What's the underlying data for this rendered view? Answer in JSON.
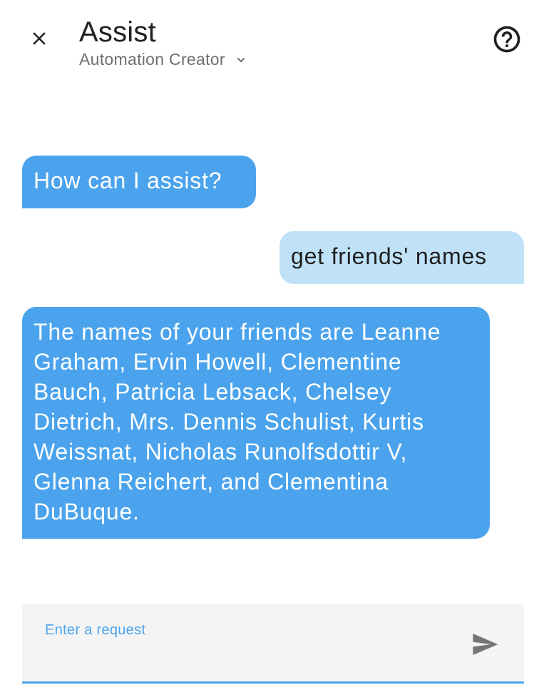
{
  "header": {
    "title": "Assist",
    "pipeline": "Automation Creator",
    "close_icon": "close-icon",
    "help_icon": "help-circle-icon",
    "chevron_icon": "chevron-down-icon"
  },
  "conversation": [
    {
      "who": "hass",
      "text": "How can I assist?"
    },
    {
      "who": "user",
      "text": "get friends' names"
    },
    {
      "who": "hass",
      "text": "The names of your friends are Leanne Graham, Ervin Howell, Clementine Bauch, Patricia Lebsack, Chelsey Dietrich, Mrs. Dennis Schulist, Kurtis Weissnat, Nicholas Runolfsdottir V, Glenna Reichert, and Clementina DuBuque."
    }
  ],
  "input": {
    "label": "Enter a request",
    "value": "",
    "send_icon": "send-icon"
  },
  "colors": {
    "assistant_bubble": "#4aa3ec",
    "user_bubble": "#c0e2f8",
    "accent": "#4aa3ec"
  }
}
